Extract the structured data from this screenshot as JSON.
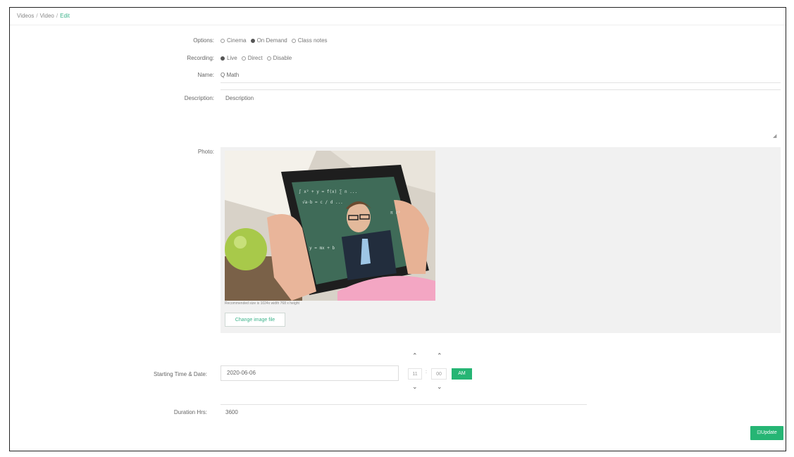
{
  "breadcrumb": {
    "items": [
      "Videos",
      "Video",
      "Edit"
    ]
  },
  "form": {
    "options": {
      "label": "Options:",
      "choices": [
        "Cinema",
        "On Demand",
        "Class notes"
      ],
      "selected": 1
    },
    "recording": {
      "label": "Recording:",
      "choices": [
        "Live",
        "Direct",
        "Disable"
      ],
      "selected": 0
    },
    "name": {
      "label": "Name:",
      "value": "Q Math"
    },
    "description": {
      "label": "Description:",
      "value": "Description"
    },
    "photo": {
      "label": "Photo:",
      "caption": "Recommended size is 1024x width 768 x height",
      "change_label": "Change image file"
    },
    "start": {
      "label": "Starting Time & Date:",
      "date": "2020-06-06",
      "hour": "11",
      "minute": "00",
      "ampm": "AM"
    },
    "duration": {
      "label": "Duration Hrs:",
      "value": "3600"
    }
  },
  "update_label": "Update",
  "colors": {
    "accent": "#26b574"
  }
}
